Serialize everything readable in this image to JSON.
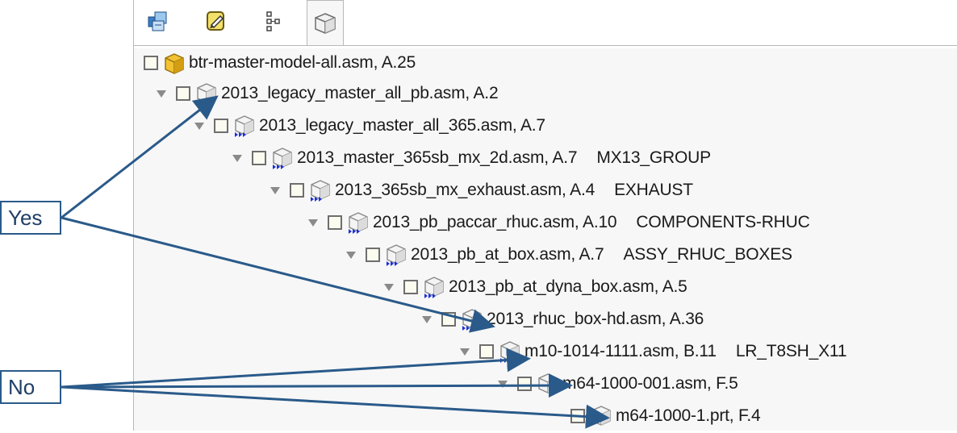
{
  "toolbar": {
    "buttons": [
      {
        "name": "cube-stack-icon"
      },
      {
        "name": "edit-note-icon"
      },
      {
        "name": "hierarchy-icon"
      },
      {
        "name": "3d-box-icon",
        "active": true
      }
    ]
  },
  "tree": {
    "rows": [
      {
        "text": "btr-master-model-all.asm, A.25",
        "tag": ""
      },
      {
        "text": "2013_legacy_master_all_pb.asm, A.2",
        "tag": ""
      },
      {
        "text": "2013_legacy_master_all_365.asm, A.7",
        "tag": ""
      },
      {
        "text": "2013_master_365sb_mx_2d.asm, A.7",
        "tag": "MX13_GROUP"
      },
      {
        "text": "2013_365sb_mx_exhaust.asm, A.4",
        "tag": "EXHAUST"
      },
      {
        "text": "2013_pb_paccar_rhuc.asm, A.10",
        "tag": "COMPONENTS-RHUC"
      },
      {
        "text": "2013_pb_at_box.asm, A.7",
        "tag": "ASSY_RHUC_BOXES"
      },
      {
        "text": "2013_pb_at_dyna_box.asm, A.5",
        "tag": ""
      },
      {
        "text": "2013_rhuc_box-hd.asm, A.36",
        "tag": ""
      },
      {
        "text": "m10-1014-1111.asm, B.11",
        "tag": "LR_T8SH_X11"
      },
      {
        "text": "m64-1000-001.asm, F.5",
        "tag": ""
      },
      {
        "text": "m64-1000-1.prt, F.4",
        "tag": ""
      }
    ]
  },
  "callouts": {
    "yes": "Yes",
    "no": "No"
  },
  "colors": {
    "callout_line": "#2a5a8a",
    "marker_blue": "#1a2fd6"
  }
}
